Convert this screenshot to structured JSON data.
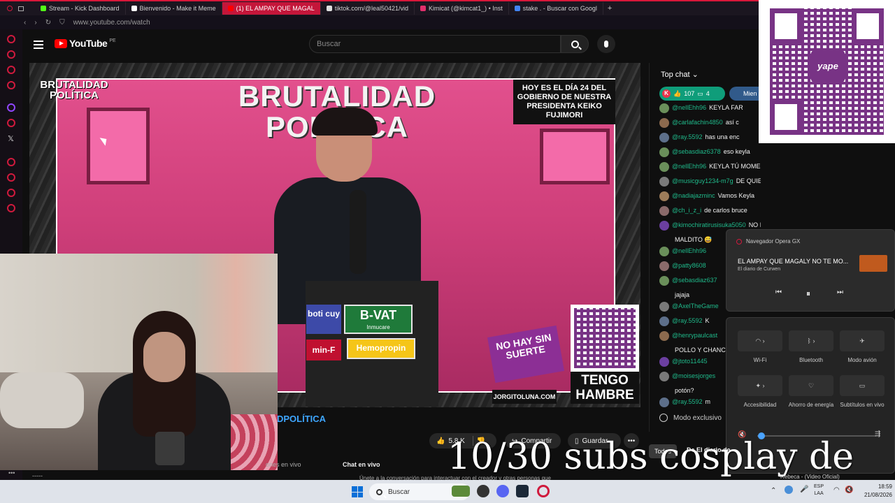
{
  "browser": {
    "tabs": [
      {
        "label": "Stream - Kick Dashboard",
        "color": "#53fc18"
      },
      {
        "label": "Bienvenido - Make it Meme",
        "color": "#ffffff"
      },
      {
        "label": "(1) EL AMPAY QUE MAGAL",
        "color": "#ff0000"
      },
      {
        "label": "tiktok.com/@leal50421/vid",
        "color": "#222222"
      },
      {
        "label": "Kimicat (@kimcat1_) • Inst",
        "color": "#e1306c"
      },
      {
        "label": "stake . - Buscar con Googl",
        "color": "#4285f4"
      }
    ],
    "new_tab": "+",
    "url": "www.youtube.com/watch"
  },
  "youtube": {
    "brand": "YouTube",
    "region": "PE",
    "search_placeholder": "Buscar"
  },
  "video": {
    "show_title": "BRUTALIDAD POLÍTICA",
    "logo_text": "BRUTALIDAD POLÍTICA",
    "day_box": "HOY ES EL DÍA 24 DEL GOBIERNO DE NUESTRA PRESIDENTA KEIKO FUJIMORI",
    "ads": {
      "bvat": "B-VAT",
      "bvat_sub": "Inmucare",
      "hemo": "Hemopropin",
      "boti": "boti cuy",
      "minf": "min-F"
    },
    "sticker": "NO HAY SIN SUERTE",
    "website": "JORGITOLUNA.COM",
    "hambre": "TENGO HAMBRE",
    "title_fragment": "DPOLÍTICA",
    "likes": "5.8 K",
    "share_label": "Compartir",
    "save_label": "Guardar",
    "more_label": "•••",
    "live_tab": "ones en vivo",
    "chat_live": "Chat en vivo",
    "join_text": "Únete a la conversación para interactuar con el creador y otras personas que",
    "dash": "-----"
  },
  "chat": {
    "header": "Top chat",
    "pill_count": "107",
    "pill_messages": "4",
    "pill2_label": "Mien",
    "messages": [
      {
        "user": "@nellEhh96",
        "text": "KEYLA FAR",
        "avatar": "#6a8f5a"
      },
      {
        "user": "@carlafachin4850",
        "text": "así c",
        "avatar": "#8c6a4e"
      },
      {
        "user": "@ray.5592",
        "text": "has una enc",
        "avatar": "#5d6f8a"
      },
      {
        "user": "@sebasdiaz6378",
        "text": "eso keyla",
        "avatar": "#6a8f5a"
      },
      {
        "user": "@nellEhh96",
        "text": "KEYLA TÚ MOMENTO LLEGÓ",
        "avatar": "#6a8f5a"
      },
      {
        "user": "@musicguy1234-m7g",
        "text": "DE QUIEN HABLA???? DIGANMEEEEE",
        "avatar": "#7a7a7a"
      },
      {
        "user": "@nadiajazminc",
        "text": "Vamos Keyla",
        "avatar": "#9c7c5a"
      },
      {
        "user": "@ch_i_z_i",
        "text": "de carlos bruce",
        "avatar": "#8a6a6a"
      },
      {
        "user": "@kimochiratirusisuka5050",
        "text": "NO HAS TENIDO PIEDAD",
        "avatar": "#6b3fa0"
      },
      {
        "user": "",
        "text": "MALDITO 😅",
        "avatar": ""
      },
      {
        "user": "@nellEhh96",
        "text": "",
        "avatar": "#6a8f5a"
      },
      {
        "user": "@patty8608",
        "text": "",
        "avatar": "#8a6a6a"
      },
      {
        "user": "@sebasdiaz637",
        "text": "",
        "avatar": "#6a8f5a"
      },
      {
        "user": "",
        "text": "jajaja",
        "avatar": ""
      },
      {
        "user": "@AxelTheGame",
        "text": "",
        "avatar": "#7a7a7a"
      },
      {
        "user": "@ray.5592",
        "text": "K",
        "avatar": "#5d6f8a"
      },
      {
        "user": "@henrypaulcast",
        "text": "",
        "avatar": "#8c6a4e"
      },
      {
        "user": "",
        "text": "POLLO Y CHANC",
        "avatar": ""
      },
      {
        "user": "@jtoto11445",
        "text": "",
        "avatar": "#6b3fa0"
      },
      {
        "user": "@moisesjorges",
        "text": "",
        "avatar": "#7a7a7a"
      },
      {
        "user": "",
        "text": "potón?",
        "avatar": ""
      },
      {
        "user": "@ray.5592",
        "text": "m",
        "avatar": "#5d6f8a"
      }
    ],
    "slow_mode": "Modo exclusivo"
  },
  "yape": {
    "mark": "yape"
  },
  "media": {
    "app": "Navegador Opera GX",
    "title": "EL AMPAY QUE MAGALY NO TE MO...",
    "subtitle": "El diario de Curwen",
    "prev": "⏮",
    "pause": "⏸",
    "next": "⏭"
  },
  "quick_settings": {
    "tiles": [
      {
        "label": "Wi-Fi",
        "glyph": "◠  ›"
      },
      {
        "label": "Bluetooth",
        "glyph": "ᛒ  ›"
      },
      {
        "label": "Modo avión",
        "glyph": "✈"
      },
      {
        "label": "Accesibilidad",
        "glyph": "✦ ›"
      },
      {
        "label": "Ahorro de energía",
        "glyph": "♡"
      },
      {
        "label": "Subtítulos en vivo",
        "glyph": "▭"
      }
    ],
    "volume_level": 0.03
  },
  "overlay": {
    "subs_text": "10/30 subs cosplay de",
    "todos": "Todos",
    "de_diario": "De El diario de",
    "rebeca": "Rebeca - (Video Oficial)"
  },
  "taskbar": {
    "search": "Buscar",
    "lang_top": "ESP",
    "lang_bottom": "LAA",
    "time": "18:59",
    "date": "21/08/2026",
    "apps": [
      {
        "name": "explorer",
        "color": "#5c8a3a"
      },
      {
        "name": "obs",
        "color": "#333333"
      },
      {
        "name": "discord",
        "color": "#5865f2"
      },
      {
        "name": "steam",
        "color": "#1b2838"
      },
      {
        "name": "opera",
        "color": "#d01a3d"
      }
    ]
  }
}
